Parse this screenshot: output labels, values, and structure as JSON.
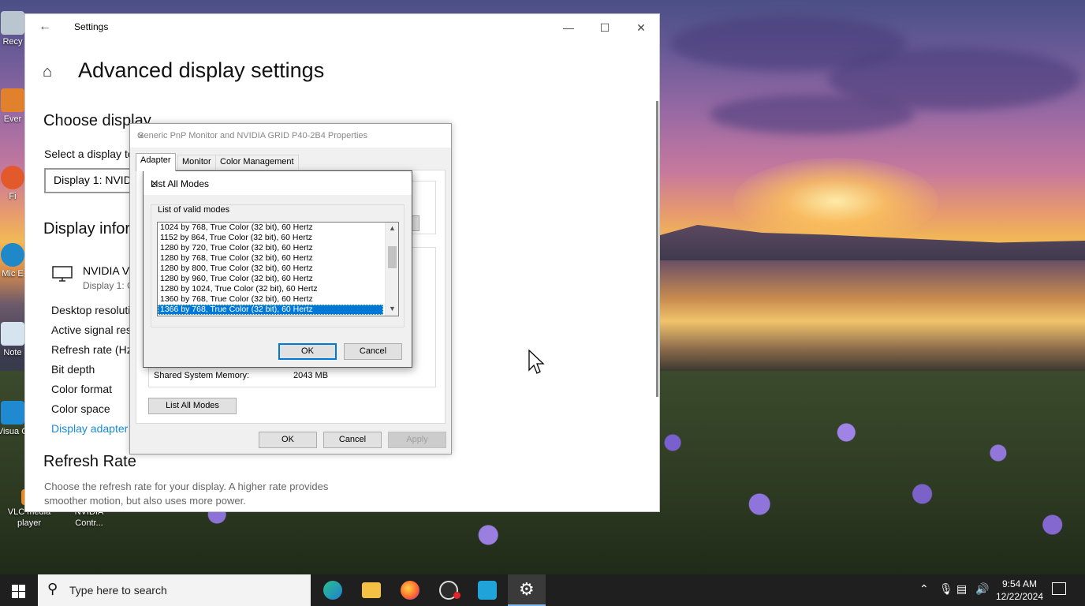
{
  "desktop": {
    "icons": [
      {
        "label": "Recy",
        "name": "recycle-bin-icon"
      },
      {
        "label": "Ever",
        "name": "everything-icon"
      },
      {
        "label": "Fi",
        "name": "firefox-shortcut-icon"
      },
      {
        "label": "Mic E",
        "name": "edge-shortcut-icon"
      },
      {
        "label": "Note",
        "name": "notepad-icon"
      },
      {
        "label": "Visua C",
        "name": "visual-studio-code-icon"
      },
      {
        "label": "VLC media player",
        "name": "vlc-icon"
      },
      {
        "label": "NVIDIA Contr...",
        "name": "nvidia-control-panel-icon"
      }
    ]
  },
  "settings": {
    "window_title": "Settings",
    "page_title": "Advanced display settings",
    "choose_display_heading": "Choose display",
    "select_display_label": "Select a display to",
    "display_combo_value": "Display 1: NVIDI",
    "display_info_heading": "Display infor",
    "monitor_name": "NVIDIA VG",
    "monitor_sub": "Display 1: C",
    "info_rows": [
      "Desktop resoluti",
      "Active signal res",
      "Refresh rate (Hz)",
      "Bit depth",
      "Color format",
      "Color space"
    ],
    "adapter_link": "Display adapter",
    "refresh_heading": "Refresh Rate",
    "refresh_desc_line1": "Choose the refresh rate for your display. A higher rate provides",
    "refresh_desc_line2": "smoother motion, but also uses more power."
  },
  "properties": {
    "title": "Generic PnP Monitor and NVIDIA GRID P40-2B4 Properties",
    "tabs": [
      "Adapter",
      "Monitor",
      "Color Management"
    ],
    "active_tab": "Adapter",
    "memory_label": "Shared System Memory:",
    "memory_value": "2043 MB",
    "list_all_modes_button": "List All Modes",
    "ok": "OK",
    "cancel": "Cancel",
    "apply": "Apply"
  },
  "list_modes": {
    "title": "List All Modes",
    "group_label": "List of valid modes",
    "modes": [
      "1024 by 768, True Color (32 bit), 60 Hertz",
      "1152 by 864, True Color (32 bit), 60 Hertz",
      "1280 by 720, True Color (32 bit), 60 Hertz",
      "1280 by 768, True Color (32 bit), 60 Hertz",
      "1280 by 800, True Color (32 bit), 60 Hertz",
      "1280 by 960, True Color (32 bit), 60 Hertz",
      "1280 by 1024, True Color (32 bit), 60 Hertz",
      "1360 by 768, True Color (32 bit), 60 Hertz",
      "1366 by 768, True Color (32 bit), 60 Hertz"
    ],
    "selected_index": 8,
    "ok": "OK",
    "cancel": "Cancel"
  },
  "taskbar": {
    "search_placeholder": "Type here to search",
    "apps": [
      "edge-icon",
      "file-explorer-icon",
      "firefox-icon",
      "obs-icon",
      "ccleaner-icon",
      "settings-icon"
    ],
    "time": "9:54 AM",
    "date": "12/22/2024"
  },
  "colors": {
    "accent": "#0078d7",
    "link": "#1a8ad4",
    "taskbar": "#1f1f1f"
  }
}
